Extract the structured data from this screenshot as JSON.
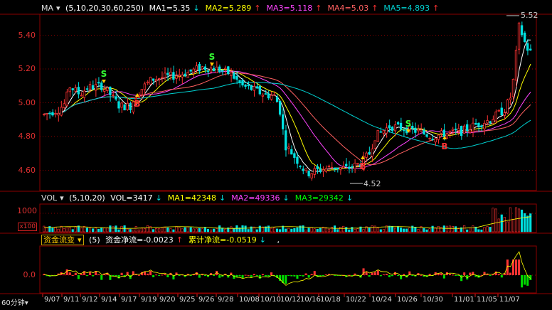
{
  "colors": {
    "up": "#ff3333",
    "down": "#00e0e0",
    "ma1": "#ffffff",
    "ma2": "#ffff00",
    "ma3": "#ff44ff",
    "ma4": "#ff6060",
    "ma5": "#00d0d0",
    "grid": "#8b0000",
    "axis": "#d02020",
    "signal_s": "#33ff33",
    "signal_b": "#ff3333",
    "accent": "#ffcc00"
  },
  "price_panel": {
    "indicator_label": "MA",
    "params": "(5,10,20,30,60,250)",
    "ma_items": [
      {
        "label": "MA1=5.35",
        "arrow": "↓",
        "color": "#ffffff"
      },
      {
        "label": "MA2=5.289",
        "arrow": "↑",
        "color": "#ffff00"
      },
      {
        "label": "MA3=5.118",
        "arrow": "↑",
        "color": "#ff44ff"
      },
      {
        "label": "MA4=5.03",
        "arrow": "↑",
        "color": "#ff6060"
      },
      {
        "label": "MA5=4.893",
        "arrow": "↑",
        "color": "#00d0d0"
      }
    ],
    "y_ticks": [
      "5.40",
      "5.20",
      "5.00",
      "4.80",
      "4.60"
    ],
    "high_label": "5.52",
    "low_label": "4.52"
  },
  "volume_panel": {
    "indicator_label": "VOL",
    "params": "(5,10,20)",
    "items": [
      {
        "label": "VOL=3417",
        "arrow": "↓",
        "color": "#ffffff"
      },
      {
        "label": "MA1=42348",
        "arrow": "↓",
        "color": "#ffff00"
      },
      {
        "label": "MA2=49336",
        "arrow": "↓",
        "color": "#ff44ff"
      },
      {
        "label": "MA3=29342",
        "arrow": "↓",
        "color": "#00ff00"
      }
    ],
    "y_tick": "1000",
    "unit_tick": "x100"
  },
  "flow_panel": {
    "indicator_label": "资金流变",
    "params": "(5)",
    "items": [
      {
        "label": "资金净流=-0.0023",
        "arrow": "↑",
        "color": "#ffffff"
      },
      {
        "label": "累计净流=-0.0519",
        "arrow": "↓",
        "color": "#ffff00"
      }
    ],
    "trailing": ",",
    "y_tick": "0.0"
  },
  "period_label": "60分钟",
  "x_labels": [
    "9/07",
    "9/11",
    "9/12",
    "9/14",
    "9/17",
    "9/19",
    "9/20",
    "9/25",
    "9/26",
    "9/28",
    "10/08",
    "10/10",
    "10/12",
    "10/16",
    "10/18",
    "10/22",
    "10/24",
    "10/26",
    "10/30",
    "11/01",
    "11/05",
    "11/07"
  ],
  "signals": [
    {
      "type": "S",
      "x": 146,
      "y": 108
    },
    {
      "type": "B",
      "x": 193,
      "y": 150
    },
    {
      "type": "S",
      "x": 298,
      "y": 84
    },
    {
      "type": "B",
      "x": 510,
      "y": 238
    },
    {
      "type": "S",
      "x": 574,
      "y": 178
    },
    {
      "type": "B",
      "x": 625,
      "y": 210
    }
  ],
  "chart_data": {
    "type": "candlestick",
    "y_ticks": [
      5.4,
      5.2,
      5.0,
      4.8,
      4.6
    ],
    "high": 5.52,
    "low": 4.52,
    "path_keys": [
      [
        0,
        4.93
      ],
      [
        20,
        4.96
      ],
      [
        30,
        5.0
      ],
      [
        35,
        5.1
      ],
      [
        50,
        5.05
      ],
      [
        60,
        5.09
      ],
      [
        80,
        5.1
      ],
      [
        90,
        5.06
      ],
      [
        105,
        4.98
      ],
      [
        120,
        4.98
      ],
      [
        130,
        5.06
      ],
      [
        150,
        5.14
      ],
      [
        180,
        5.16
      ],
      [
        200,
        5.18
      ],
      [
        220,
        5.21
      ],
      [
        240,
        5.2
      ],
      [
        260,
        5.17
      ],
      [
        275,
        5.1
      ],
      [
        290,
        5.08
      ],
      [
        305,
        5.05
      ],
      [
        320,
        5.04
      ],
      [
        327,
        4.98
      ],
      [
        335,
        4.75
      ],
      [
        345,
        4.7
      ],
      [
        355,
        4.64
      ],
      [
        365,
        4.58
      ],
      [
        380,
        4.6
      ],
      [
        400,
        4.62
      ],
      [
        420,
        4.61
      ],
      [
        440,
        4.64
      ],
      [
        452,
        4.7
      ],
      [
        460,
        4.8
      ],
      [
        480,
        4.86
      ],
      [
        500,
        4.85
      ],
      [
        520,
        4.83
      ],
      [
        540,
        4.8
      ],
      [
        560,
        4.82
      ],
      [
        580,
        4.83
      ],
      [
        600,
        4.87
      ],
      [
        620,
        4.9
      ],
      [
        640,
        4.96
      ],
      [
        650,
        5.05
      ],
      [
        655,
        5.25
      ],
      [
        660,
        5.45
      ],
      [
        665,
        5.4
      ],
      [
        670,
        5.33
      ],
      [
        676,
        5.3
      ]
    ]
  }
}
